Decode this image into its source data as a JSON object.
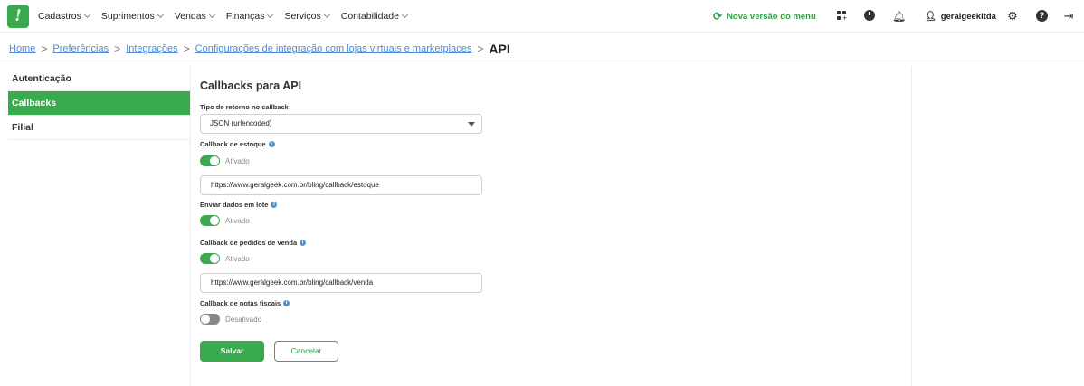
{
  "brand": {
    "logo_text": "!",
    "accent": "#3aaa4f"
  },
  "topnav": {
    "menu": [
      {
        "label": "Cadastros"
      },
      {
        "label": "Suprimentos"
      },
      {
        "label": "Vendas"
      },
      {
        "label": "Finanças"
      },
      {
        "label": "Serviços"
      },
      {
        "label": "Contabilidade"
      }
    ],
    "new_menu_label": "Nova versão do menu",
    "username": "geralgeekltda",
    "icons": [
      "apps-icon",
      "clock-icon",
      "bell-icon",
      "user-icon",
      "gear-icon",
      "help-icon",
      "logout-icon"
    ]
  },
  "breadcrumb": {
    "items": [
      "Home",
      "Preferências",
      "Integrações",
      "Configurações de integração com lojas virtuais e marketplaces"
    ],
    "current": "API"
  },
  "sidebar": {
    "items": [
      {
        "label": "Autenticação",
        "active": false
      },
      {
        "label": "Callbacks",
        "active": true
      },
      {
        "label": "Filial",
        "active": false
      }
    ]
  },
  "form": {
    "title": "Callbacks para API",
    "return_type": {
      "label": "Tipo de retorno no callback",
      "value": "JSON (urlencoded)"
    },
    "stock": {
      "label": "Callback de estoque",
      "state": "Ativado",
      "url": "https://www.geralgeek.com.br/bling/callback/estoque"
    },
    "batch": {
      "label": "Enviar dados em lote",
      "state": "Ativado"
    },
    "orders": {
      "label": "Callback de pedidos de venda",
      "state": "Ativado",
      "url": "https://www.geralgeek.com.br/bling/callback/venda"
    },
    "invoices": {
      "label": "Callback de notas fiscais",
      "state": "Desativado"
    },
    "save_label": "Salvar",
    "cancel_label": "Cancelar"
  }
}
